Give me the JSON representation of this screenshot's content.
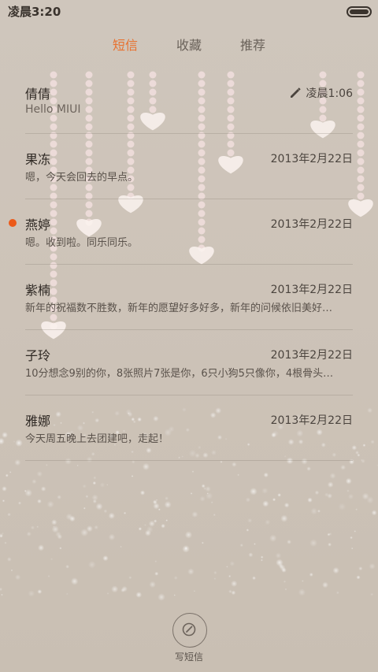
{
  "status_bar": {
    "time": "凌晨3:20"
  },
  "tabs": [
    {
      "label": "短信",
      "active": true
    },
    {
      "label": "收藏",
      "active": false
    },
    {
      "label": "推荐",
      "active": false
    }
  ],
  "conversations": [
    {
      "name": "倩倩",
      "snippet": "Hello MIUI",
      "date": "凌晨1:06",
      "draft": true,
      "unread": false
    },
    {
      "name": "果冻",
      "snippet": "嗯，今天会回去的早点。",
      "date": "2013年2月22日",
      "draft": false,
      "unread": false
    },
    {
      "name": "燕婷",
      "snippet": "嗯。收到啦。同乐同乐。",
      "date": "2013年2月22日",
      "draft": false,
      "unread": true
    },
    {
      "name": "紫楠",
      "snippet": "新年的祝福数不胜数，新年的愿望好多好多，新年的问候依旧美好…",
      "date": "2013年2月22日",
      "draft": false,
      "unread": false
    },
    {
      "name": "子玲",
      "snippet": "10分想念9别的你，8张照片7张是你，6只小狗5只像你，4根骨头…",
      "date": "2013年2月22日",
      "draft": false,
      "unread": false
    },
    {
      "name": "雅娜",
      "snippet": "今天周五晚上去团建吧，走起！",
      "date": "2013年2月22日",
      "draft": false,
      "unread": false
    }
  ],
  "compose": {
    "label": "写短信",
    "icon": "compose-icon"
  },
  "colors": {
    "accent": "#e8712e",
    "unread_dot": "#ec5a19"
  }
}
